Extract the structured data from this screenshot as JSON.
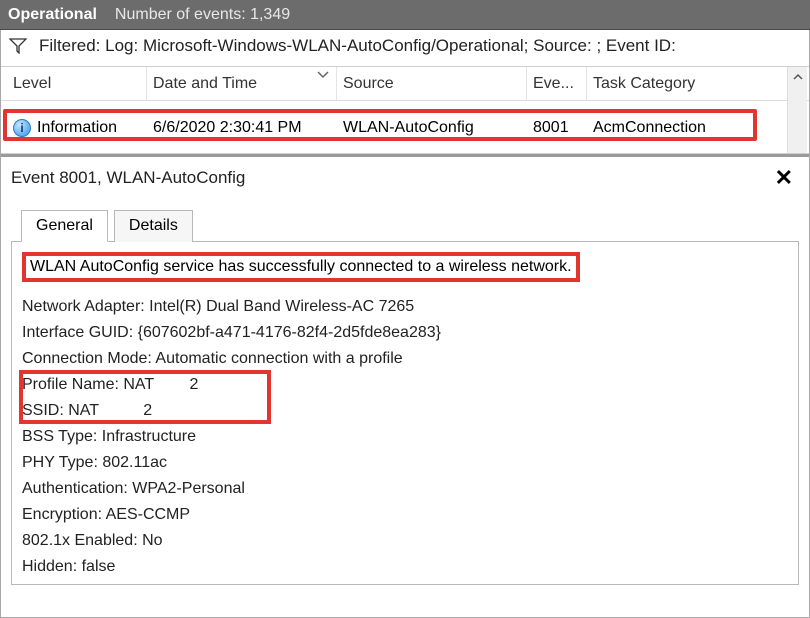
{
  "header": {
    "title": "Operational",
    "count_label": "Number of events: 1,349"
  },
  "filter": {
    "text": "Filtered: Log: Microsoft-Windows-WLAN-AutoConfig/Operational; Source: ; Event ID:"
  },
  "columns": {
    "level": "Level",
    "datetime": "Date and Time",
    "source": "Source",
    "eventid": "Eve...",
    "category": "Task Category"
  },
  "row": {
    "level": "Information",
    "datetime": "6/6/2020 2:30:41 PM",
    "source": "WLAN-AutoConfig",
    "eventid": "8001",
    "category": "AcmConnection"
  },
  "detail": {
    "title": "Event 8001, WLAN-AutoConfig",
    "tabs": {
      "general": "General",
      "details": "Details"
    },
    "message": "WLAN AutoConfig service has successfully connected to a wireless network.",
    "kv": {
      "adapter": "Network Adapter: Intel(R) Dual Band Wireless-AC 7265",
      "guid": "Interface GUID: {607602bf-a471-4176-82f4-2d5fde8ea283}",
      "mode": "Connection Mode: Automatic connection with a profile",
      "profile": "Profile Name: NAT        2",
      "ssid": "SSID: NAT          2",
      "bss": "BSS Type: Infrastructure",
      "phy": "PHY Type: 802.11ac",
      "auth": "Authentication: WPA2-Personal",
      "enc": "Encryption: AES-CCMP",
      "dot1x": "802.1x Enabled: No",
      "hidden": "Hidden: false"
    }
  }
}
